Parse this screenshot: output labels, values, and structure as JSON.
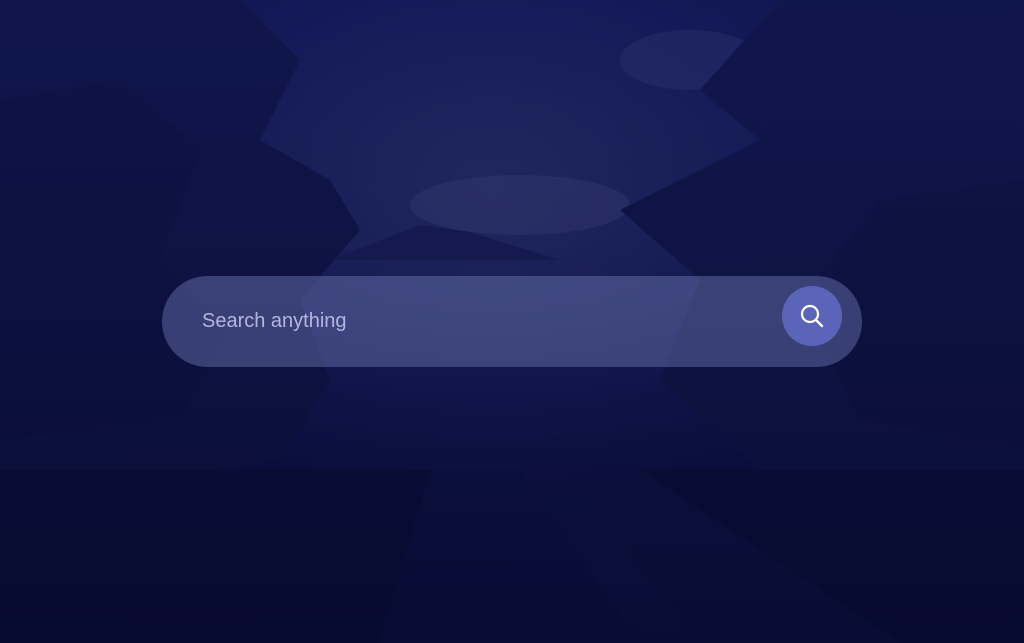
{
  "search": {
    "placeholder": "Search anything",
    "value": ""
  },
  "icons": {
    "search_button": "search-icon"
  },
  "colors": {
    "background": "#0a0f3e",
    "search_bar": "#7880be",
    "search_button": "#5a64b8",
    "placeholder_text": "#b3b6df"
  }
}
